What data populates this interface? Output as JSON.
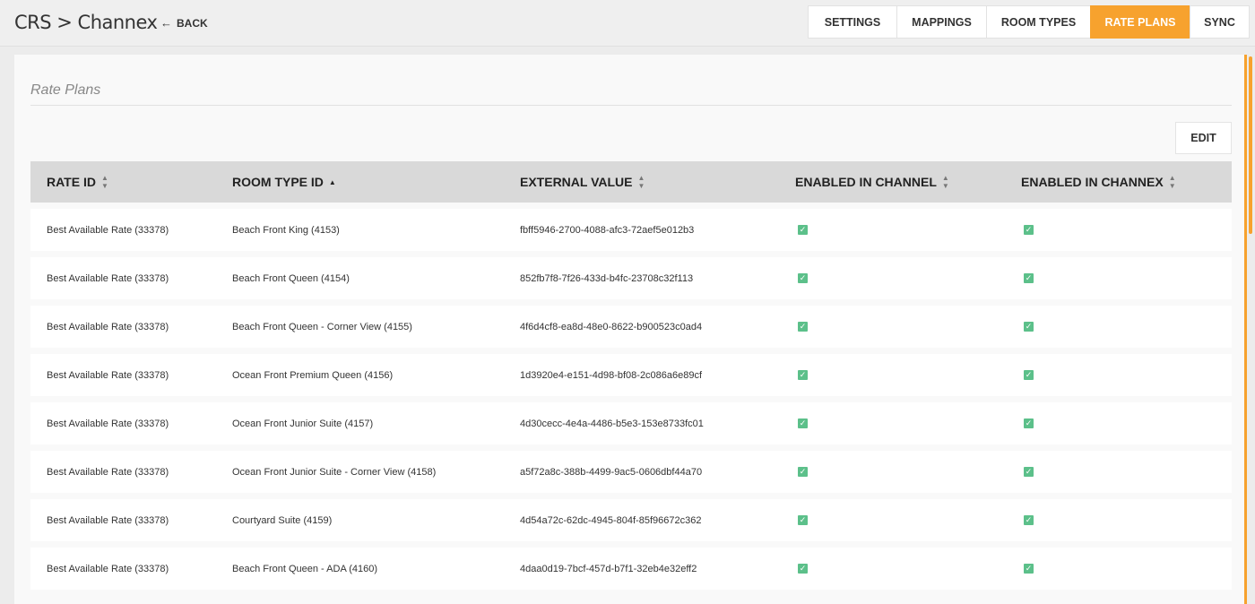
{
  "header": {
    "title": "CRS > Channex",
    "back_label": "BACK",
    "tabs": [
      {
        "label": "SETTINGS",
        "active": false
      },
      {
        "label": "MAPPINGS",
        "active": false
      },
      {
        "label": "ROOM TYPES",
        "active": false
      },
      {
        "label": "RATE PLANS",
        "active": true
      },
      {
        "label": "SYNC",
        "active": false
      }
    ]
  },
  "panel": {
    "title": "Rate Plans",
    "edit_label": "EDIT"
  },
  "table": {
    "columns": [
      {
        "label": "RATE ID",
        "sort": "none"
      },
      {
        "label": "ROOM TYPE ID",
        "sort": "asc"
      },
      {
        "label": "EXTERNAL VALUE",
        "sort": "none"
      },
      {
        "label": "ENABLED IN CHANNEL",
        "sort": "none"
      },
      {
        "label": "ENABLED IN CHANNEX",
        "sort": "none"
      }
    ],
    "rows": [
      {
        "rate_id": "Best Available Rate (33378)",
        "room_type": "Beach Front King (4153)",
        "external": "fbff5946-2700-4088-afc3-72aef5e012b3",
        "channel": true,
        "channex": true
      },
      {
        "rate_id": "Best Available Rate (33378)",
        "room_type": "Beach Front Queen (4154)",
        "external": "852fb7f8-7f26-433d-b4fc-23708c32f113",
        "channel": true,
        "channex": true
      },
      {
        "rate_id": "Best Available Rate (33378)",
        "room_type": "Beach Front Queen - Corner View (4155)",
        "external": "4f6d4cf8-ea8d-48e0-8622-b900523c0ad4",
        "channel": true,
        "channex": true
      },
      {
        "rate_id": "Best Available Rate (33378)",
        "room_type": "Ocean Front Premium Queen (4156)",
        "external": "1d3920e4-e151-4d98-bf08-2c086a6e89cf",
        "channel": true,
        "channex": true
      },
      {
        "rate_id": "Best Available Rate (33378)",
        "room_type": "Ocean Front Junior Suite (4157)",
        "external": "4d30cecc-4e4a-4486-b5e3-153e8733fc01",
        "channel": true,
        "channex": true
      },
      {
        "rate_id": "Best Available Rate (33378)",
        "room_type": "Ocean Front Junior Suite - Corner View (4158)",
        "external": "a5f72a8c-388b-4499-9ac5-0606dbf44a70",
        "channel": true,
        "channex": true
      },
      {
        "rate_id": "Best Available Rate (33378)",
        "room_type": "Courtyard Suite (4159)",
        "external": "4d54a72c-62dc-4945-804f-85f96672c362",
        "channel": true,
        "channex": true
      },
      {
        "rate_id": "Best Available Rate (33378)",
        "room_type": "Beach Front Queen - ADA (4160)",
        "external": "4daa0d19-7bcf-457d-b7f1-32eb4e32eff2",
        "channel": true,
        "channex": true
      }
    ]
  },
  "colors": {
    "accent": "#f7a22e",
    "checkbox": "#5cc08a",
    "header_bg": "#d9d9d9"
  },
  "icons": {
    "back": "arrow-left-icon",
    "sort": "sort-icon",
    "check": "checkbox-checked-icon"
  }
}
